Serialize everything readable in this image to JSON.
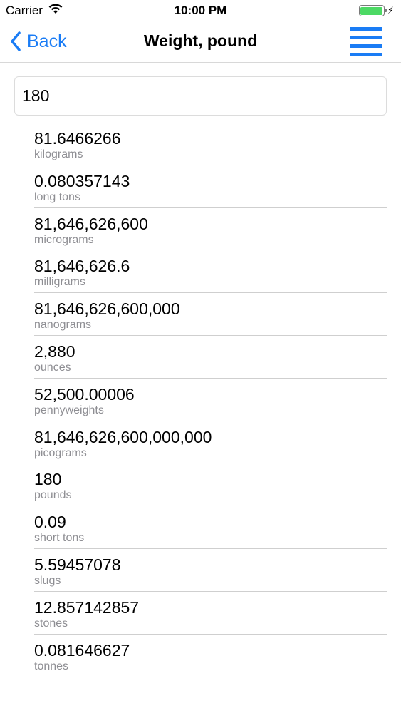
{
  "status_bar": {
    "carrier": "Carrier",
    "time": "10:00 PM",
    "battery_level": 1.0,
    "battery_color": "#4cd964"
  },
  "nav": {
    "back_label": "Back",
    "title": "Weight, pound",
    "menu_icon": "hamburger-menu-icon",
    "accent_color": "#1a7cf5"
  },
  "input": {
    "value": "180",
    "placeholder": ""
  },
  "results": [
    {
      "value": "81.6466266",
      "unit": "kilograms"
    },
    {
      "value": "0.080357143",
      "unit": "long tons"
    },
    {
      "value": "81,646,626,600",
      "unit": "micrograms"
    },
    {
      "value": "81,646,626.6",
      "unit": "milligrams"
    },
    {
      "value": "81,646,626,600,000",
      "unit": "nanograms"
    },
    {
      "value": "2,880",
      "unit": "ounces"
    },
    {
      "value": "52,500.00006",
      "unit": "pennyweights"
    },
    {
      "value": "81,646,626,600,000,000",
      "unit": "picograms"
    },
    {
      "value": "180",
      "unit": "pounds"
    },
    {
      "value": "0.09",
      "unit": "short tons"
    },
    {
      "value": "5.59457078",
      "unit": "slugs"
    },
    {
      "value": "12.857142857",
      "unit": "stones"
    },
    {
      "value": "0.081646627",
      "unit": "tonnes"
    }
  ]
}
